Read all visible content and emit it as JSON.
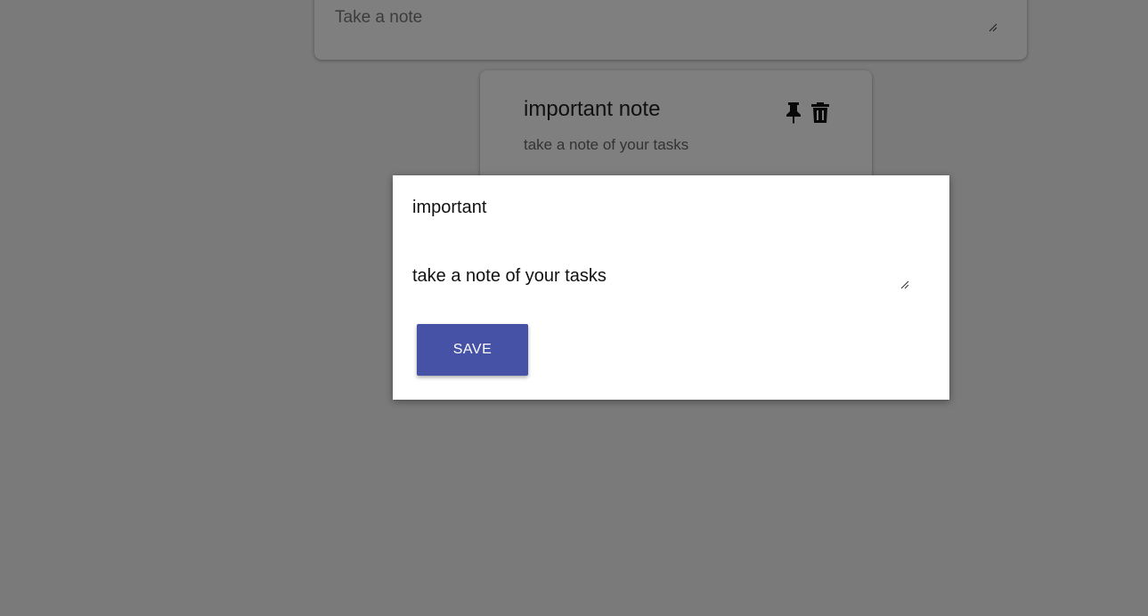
{
  "take_note": {
    "placeholder": "Take a note"
  },
  "note": {
    "title": "important note",
    "content": "take a note of your tasks",
    "icons": [
      "pin-icon",
      "trash-icon"
    ]
  },
  "edit_modal": {
    "title_value": "important",
    "content_value": "take a note of your tasks",
    "save_label": "SAVE",
    "save_color": "#4652a6"
  },
  "colors": {
    "backdrop": "rgba(0,0,0,0.5)",
    "surface": "#ffffff",
    "accent": "#4652a6"
  }
}
